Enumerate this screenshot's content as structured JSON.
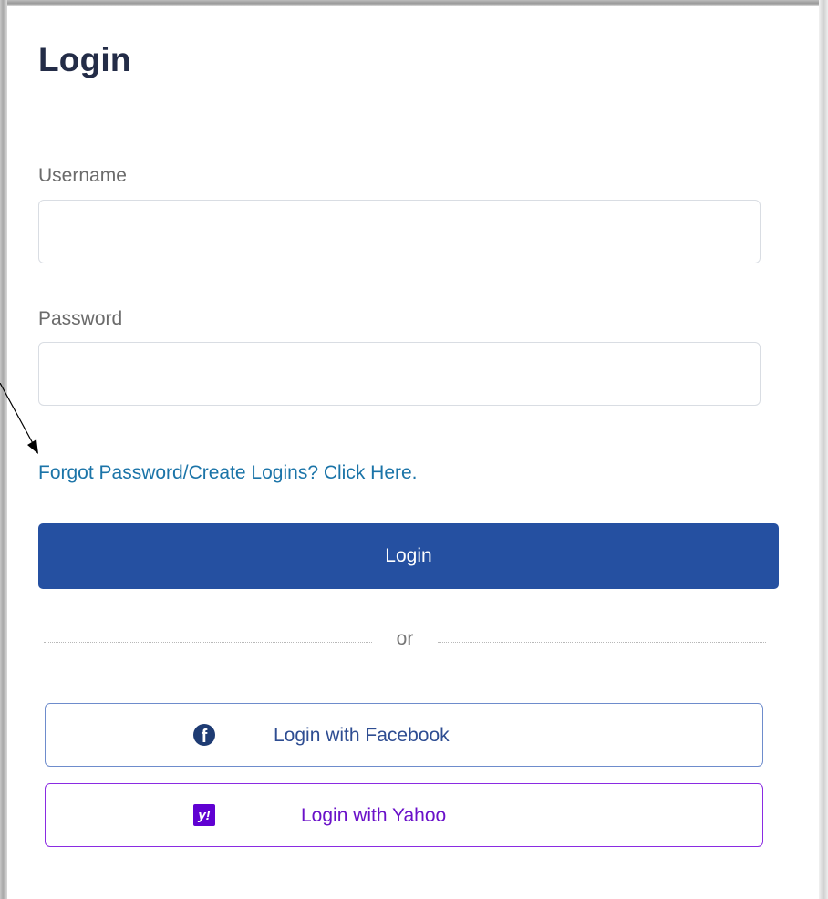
{
  "title": "Login",
  "fields": {
    "username_label": "Username",
    "username_value": "",
    "password_label": "Password",
    "password_value": ""
  },
  "forgot_link": "Forgot Password/Create Logins? Click Here.",
  "login_button": "Login",
  "divider_text": "or",
  "social": {
    "facebook_label": "Login with Facebook",
    "yahoo_label": "Login with Yahoo",
    "facebook_icon": "facebook-icon",
    "yahoo_icon": "yahoo-icon",
    "yahoo_glyph": "y!"
  },
  "colors": {
    "primary": "#2550a1",
    "link": "#1b74a8",
    "facebook_text": "#2e4d92",
    "yahoo": "#6001d2"
  }
}
